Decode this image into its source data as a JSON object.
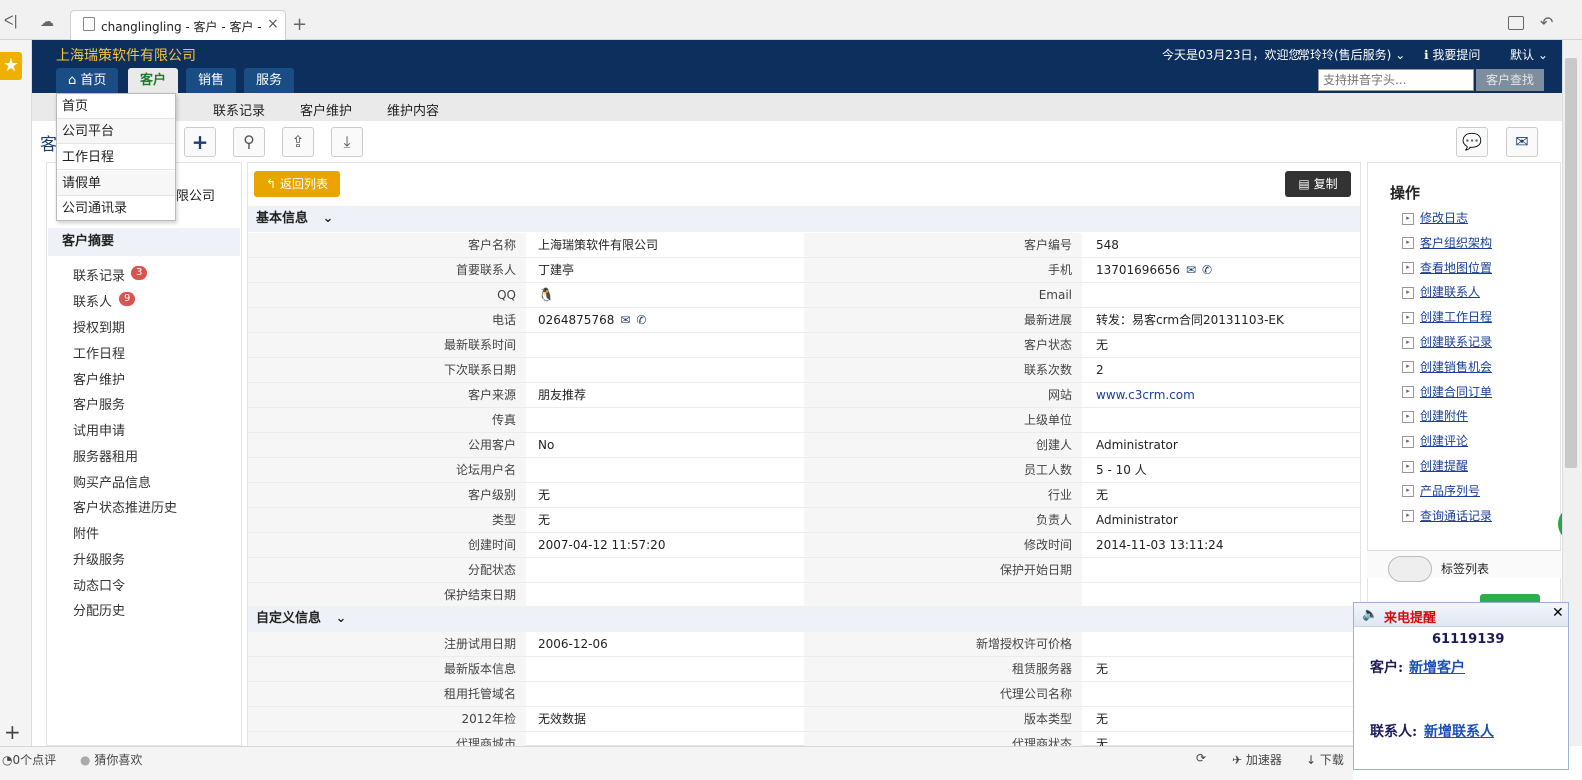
{
  "browser": {
    "tab_title": "changlingling - 客户 - 客户 - ",
    "back": "ᐸ|",
    "reload": "☁",
    "close": "×",
    "new_tab": "+"
  },
  "header": {
    "company": "上海瑞策软件有限公司",
    "nav_tabs": [
      "首页",
      "客户",
      "销售",
      "服务"
    ],
    "active_tab": "客户",
    "date_text": "今天是03月23日，欢迎您",
    "user": "常玲玲(售后服务)",
    "ask": "我要提问",
    "default": "默认",
    "search_placeholder": "支持拼音字头...",
    "search_button": "客户查找"
  },
  "subnav": [
    "联系记录",
    "客户维护",
    "维护内容"
  ],
  "home_menu": [
    "首页",
    "公司平台",
    "工作日程",
    "请假单",
    "公司通讯录"
  ],
  "page_title_char": "客",
  "left_nav": {
    "company_fragment": "限公司",
    "summary": "客户摘要",
    "items": [
      {
        "label": "联系记录",
        "badge": "3"
      },
      {
        "label": "联系人",
        "badge": "9"
      },
      {
        "label": "授权到期"
      },
      {
        "label": "工作日程"
      },
      {
        "label": "客户维护"
      },
      {
        "label": "客户服务"
      },
      {
        "label": "试用申请"
      },
      {
        "label": "服务器租用"
      },
      {
        "label": "购买产品信息"
      },
      {
        "label": "客户状态推进历史"
      },
      {
        "label": "附件"
      },
      {
        "label": "升级服务"
      },
      {
        "label": "动态口令"
      },
      {
        "label": "分配历史"
      }
    ]
  },
  "content": {
    "back_button": "返回列表",
    "copy_button": "复制",
    "basic_section": "基本信息",
    "basic_rows": [
      {
        "l": "客户名称",
        "lv": "上海瑞策软件有限公司",
        "r": "客户编号",
        "rv": "548"
      },
      {
        "l": "首要联系人",
        "lv": "丁建亭",
        "r": "手机",
        "rv": "13701696656"
      },
      {
        "l": "QQ",
        "lv": "",
        "r": "Email",
        "rv": ""
      },
      {
        "l": "电话",
        "lv": "0264875768",
        "r": "最新进展",
        "rv": "转发：易客crm合同20131103-EK"
      },
      {
        "l": "最新联系时间",
        "lv": "",
        "r": "客户状态",
        "rv": "无"
      },
      {
        "l": "下次联系日期",
        "lv": "",
        "r": "联系次数",
        "rv": "2"
      },
      {
        "l": "客户来源",
        "lv": "朋友推荐",
        "r": "网站",
        "rv": "www.c3crm.com"
      },
      {
        "l": "传真",
        "lv": "",
        "r": "上级单位",
        "rv": ""
      },
      {
        "l": "公用客户",
        "lv": "No",
        "r": "创建人",
        "rv": "Administrator"
      },
      {
        "l": "论坛用户名",
        "lv": "",
        "r": "员工人数",
        "rv": "5 - 10 人"
      },
      {
        "l": "客户级别",
        "lv": "无",
        "r": "行业",
        "rv": "无"
      },
      {
        "l": "类型",
        "lv": "无",
        "r": "负责人",
        "rv": "Administrator"
      },
      {
        "l": "创建时间",
        "lv": "2007-04-12 11:57:20",
        "r": "修改时间",
        "rv": "2014-11-03 13:11:24"
      },
      {
        "l": "分配状态",
        "lv": "",
        "r": "保护开始日期",
        "rv": ""
      },
      {
        "l": "保护结束日期",
        "lv": "",
        "r": "",
        "rv": ""
      }
    ],
    "custom_section": "自定义信息",
    "custom_rows": [
      {
        "l": "注册试用日期",
        "lv": "2006-12-06",
        "r": "新增授权许可价格",
        "rv": ""
      },
      {
        "l": "最新版本信息",
        "lv": "",
        "r": "租赁服务器",
        "rv": "无"
      },
      {
        "l": "租用托管域名",
        "lv": "",
        "r": "代理公司名称",
        "rv": ""
      },
      {
        "l": "2012年检",
        "lv": "无效数据",
        "r": "版本类型",
        "rv": "无"
      },
      {
        "l": "代理商城市",
        "lv": "",
        "r": "代理商状态",
        "rv": "无"
      }
    ]
  },
  "right_panel": {
    "title": "操作",
    "links": [
      "修改日志",
      "客户组织架构",
      "查看地图位置",
      "创建联系人",
      "创建工作日程",
      "创建联系记录",
      "创建销售机会",
      "创建合同订单",
      "创建附件",
      "创建评论",
      "创建提醒",
      "产品序列号",
      "查询通话记录"
    ],
    "tag_label": "标签列表"
  },
  "call_popup": {
    "title": "来电提醒",
    "number": "61119139",
    "customer_label": "客户:",
    "customer_link": "新增客户",
    "contact_label": "联系人:",
    "contact_link": "新增联系人"
  },
  "statusbar": {
    "reviews": "0个点评",
    "guess": "猜你喜欢",
    "accelerator": "加速器",
    "download": "下载"
  }
}
